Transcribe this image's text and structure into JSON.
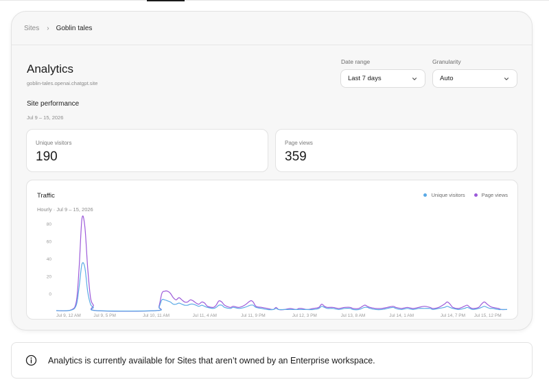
{
  "breadcrumb": {
    "root": "Sites",
    "separator": "›",
    "current": "Goblin tales"
  },
  "header": {
    "title": "Analytics",
    "subdomain": "goblin-tales.openai.chatgpt.site"
  },
  "filters": {
    "date_range": {
      "label": "Date range",
      "value": "Last 7 days"
    },
    "granularity": {
      "label": "Granularity",
      "value": "Auto"
    }
  },
  "performance": {
    "title": "Site performance",
    "date": "Jul 9 – 15, 2026",
    "unique_visitors": {
      "label": "Unique visitors",
      "value": "190"
    },
    "page_views": {
      "label": "Page views",
      "value": "359"
    }
  },
  "traffic": {
    "title": "Traffic",
    "subtitle": "Hourly · Jul 9 – 15, 2026",
    "legend": {
      "unique_visitors": "Unique visitors",
      "page_views": "Page views"
    }
  },
  "notice": {
    "text": "Analytics is currently available for Sites that aren’t owned by an Enterprise workspace."
  },
  "icons": {
    "breadcrumb_separator": "chevron-right-icon",
    "select": "chevron-down-icon",
    "notice": "info-icon"
  },
  "colors": {
    "unique_visitors": "#5aa9e6",
    "page_views": "#9b59d9",
    "card_bg": "#f7f7f7"
  },
  "chart_data": {
    "type": "line",
    "title": "Traffic",
    "subtitle": "Hourly · Jul 9 – 15, 2026",
    "y_tick_labels": [
      "80",
      "60",
      "40",
      "20",
      "0"
    ],
    "x_tick_labels": [
      "Jul 9, 12 AM",
      "Jul 9, 5 PM",
      "Jul 10, 11 AM",
      "Jul 11, 4 AM",
      "Jul 11, 9 PM",
      "Jul 12, 3 PM",
      "Jul 13, 8 AM",
      "Jul 14, 1 AM",
      "Jul 14, 7 PM",
      "Jul 15, 12 PM"
    ],
    "x_tick_hours": [
      0,
      17,
      35,
      52,
      69,
      87,
      104,
      121,
      139,
      156
    ],
    "ylim": [
      0,
      80
    ],
    "grid": false,
    "legend_position": "top-right",
    "series": [
      {
        "name": "Page views",
        "color": "#9b59d9",
        "points": [
          [
            0,
            0
          ],
          [
            5,
            0.5
          ],
          [
            7,
            8
          ],
          [
            8,
            40
          ],
          [
            9,
            85
          ],
          [
            10,
            78
          ],
          [
            11,
            40
          ],
          [
            12,
            12
          ],
          [
            13,
            5
          ],
          [
            14,
            0
          ],
          [
            35,
            0
          ],
          [
            36,
            4
          ],
          [
            37,
            16
          ],
          [
            38,
            18
          ],
          [
            39,
            18
          ],
          [
            40,
            16
          ],
          [
            41,
            12
          ],
          [
            42,
            10
          ],
          [
            43,
            12
          ],
          [
            44,
            10
          ],
          [
            45,
            8
          ],
          [
            46,
            8
          ],
          [
            47,
            10
          ],
          [
            48,
            9
          ],
          [
            49,
            7
          ],
          [
            50,
            6
          ],
          [
            51,
            8
          ],
          [
            52,
            7
          ],
          [
            53,
            4
          ],
          [
            55,
            3
          ],
          [
            56,
            5
          ],
          [
            57,
            9
          ],
          [
            58,
            8
          ],
          [
            59,
            5
          ],
          [
            61,
            3
          ],
          [
            62,
            4
          ],
          [
            64,
            3
          ],
          [
            66,
            5
          ],
          [
            68,
            9
          ],
          [
            69,
            8
          ],
          [
            70,
            4
          ],
          [
            72,
            3
          ],
          [
            74,
            2
          ],
          [
            76,
            1
          ],
          [
            77,
            3
          ],
          [
            78,
            1
          ],
          [
            80,
            1
          ],
          [
            82,
            2
          ],
          [
            84,
            1
          ],
          [
            85,
            2
          ],
          [
            86,
            2
          ],
          [
            88,
            1
          ],
          [
            90,
            2
          ],
          [
            92,
            3
          ],
          [
            93,
            6
          ],
          [
            94,
            4
          ],
          [
            95,
            3
          ],
          [
            97,
            3
          ],
          [
            99,
            2
          ],
          [
            101,
            3
          ],
          [
            103,
            3
          ],
          [
            104,
            2
          ],
          [
            106,
            2
          ],
          [
            108,
            5
          ],
          [
            109,
            4
          ],
          [
            110,
            3
          ],
          [
            112,
            2
          ],
          [
            114,
            2
          ],
          [
            116,
            3
          ],
          [
            118,
            4
          ],
          [
            119,
            3
          ],
          [
            121,
            2
          ],
          [
            123,
            3
          ],
          [
            125,
            2
          ],
          [
            127,
            3
          ],
          [
            129,
            4
          ],
          [
            131,
            3
          ],
          [
            132,
            2
          ],
          [
            134,
            3
          ],
          [
            136,
            6
          ],
          [
            137,
            8
          ],
          [
            138,
            6
          ],
          [
            139,
            3
          ],
          [
            141,
            2
          ],
          [
            143,
            4
          ],
          [
            144,
            5
          ],
          [
            145,
            3
          ],
          [
            146,
            2
          ],
          [
            148,
            3
          ],
          [
            149,
            6
          ],
          [
            150,
            8
          ],
          [
            151,
            6
          ],
          [
            152,
            4
          ],
          [
            153,
            3
          ],
          [
            155,
            2
          ],
          [
            156,
            1
          ],
          [
            158,
            1
          ]
        ]
      },
      {
        "name": "Unique visitors",
        "color": "#5aa9e6",
        "points": [
          [
            0,
            0
          ],
          [
            5,
            0.3
          ],
          [
            7,
            5
          ],
          [
            8,
            22
          ],
          [
            9,
            43
          ],
          [
            10,
            40
          ],
          [
            11,
            18
          ],
          [
            12,
            6
          ],
          [
            13,
            3
          ],
          [
            14,
            0
          ],
          [
            35,
            0
          ],
          [
            36,
            3
          ],
          [
            37,
            10
          ],
          [
            38,
            10
          ],
          [
            39,
            9
          ],
          [
            40,
            8
          ],
          [
            41,
            6
          ],
          [
            42,
            6
          ],
          [
            43,
            7
          ],
          [
            44,
            6
          ],
          [
            45,
            5
          ],
          [
            46,
            5
          ],
          [
            47,
            6
          ],
          [
            48,
            6
          ],
          [
            49,
            5
          ],
          [
            50,
            4
          ],
          [
            51,
            5
          ],
          [
            52,
            4
          ],
          [
            53,
            3
          ],
          [
            55,
            2
          ],
          [
            56,
            3
          ],
          [
            57,
            5
          ],
          [
            58,
            5
          ],
          [
            59,
            3
          ],
          [
            61,
            2
          ],
          [
            62,
            3
          ],
          [
            64,
            2
          ],
          [
            66,
            3
          ],
          [
            68,
            5
          ],
          [
            69,
            5
          ],
          [
            70,
            3
          ],
          [
            72,
            2
          ],
          [
            74,
            1
          ],
          [
            76,
            1
          ],
          [
            77,
            2
          ],
          [
            78,
            1
          ],
          [
            80,
            1
          ],
          [
            82,
            1
          ],
          [
            84,
            1
          ],
          [
            85,
            1
          ],
          [
            86,
            1
          ],
          [
            88,
            1
          ],
          [
            90,
            1
          ],
          [
            92,
            2
          ],
          [
            93,
            4
          ],
          [
            94,
            3
          ],
          [
            95,
            2
          ],
          [
            97,
            2
          ],
          [
            99,
            1
          ],
          [
            101,
            2
          ],
          [
            103,
            2
          ],
          [
            104,
            1
          ],
          [
            106,
            1
          ],
          [
            108,
            3
          ],
          [
            109,
            3
          ],
          [
            110,
            2
          ],
          [
            112,
            1
          ],
          [
            114,
            1
          ],
          [
            116,
            2
          ],
          [
            118,
            3
          ],
          [
            119,
            2
          ],
          [
            121,
            1
          ],
          [
            123,
            2
          ],
          [
            125,
            1
          ],
          [
            127,
            2
          ],
          [
            129,
            2
          ],
          [
            131,
            2
          ],
          [
            132,
            1
          ],
          [
            134,
            2
          ],
          [
            136,
            3
          ],
          [
            137,
            4
          ],
          [
            138,
            3
          ],
          [
            139,
            2
          ],
          [
            141,
            1
          ],
          [
            143,
            2
          ],
          [
            144,
            3
          ],
          [
            145,
            2
          ],
          [
            146,
            1
          ],
          [
            148,
            2
          ],
          [
            149,
            3
          ],
          [
            150,
            4
          ],
          [
            151,
            3
          ],
          [
            152,
            2
          ],
          [
            153,
            2
          ],
          [
            155,
            1
          ],
          [
            156,
            1
          ],
          [
            158,
            1
          ]
        ]
      }
    ]
  }
}
